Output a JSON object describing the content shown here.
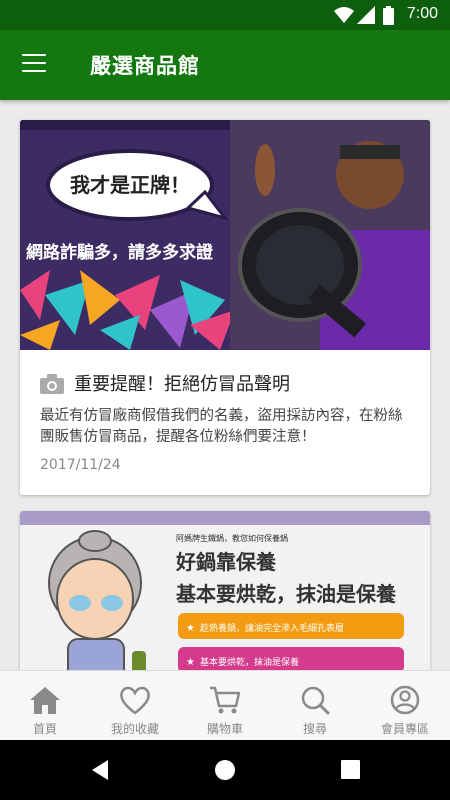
{
  "status_bar": {
    "time": "7:00"
  },
  "app_bar": {
    "title": "嚴選商品館",
    "menu_icon": "hamburger-menu-icon"
  },
  "posts": [
    {
      "banner_text_bubble": "我才是正牌！",
      "banner_text_sub": "網路詐騙多，請多多求證",
      "title": "重要提醒！拒絕仿冒品聲明",
      "description": "最近有仿冒廠商假借我們的名義，盜用採訪內容，在粉絲團販售仿冒商品，提醒各位粉絲們要注意！",
      "date": "2017/11/24"
    },
    {
      "banner_header": "阿媽牌生鐵鍋，教您如何保養鍋",
      "banner_title_1": "好鍋靠保養",
      "banner_title_2": "基本要烘乾，抹油是保養",
      "tip_1": "趁熱養鍋，讓油完全滲入毛細孔表層",
      "tip_2": "基本要烘乾，抹油是保養"
    }
  ],
  "bottom_nav": [
    {
      "label": "首頁",
      "icon": "home-icon"
    },
    {
      "label": "我的收藏",
      "icon": "heart-icon"
    },
    {
      "label": "購物車",
      "icon": "cart-icon"
    },
    {
      "label": "搜尋",
      "icon": "search-icon"
    },
    {
      "label": "會員專區",
      "icon": "account-icon"
    }
  ],
  "colors": {
    "primary": "#13780f",
    "status_bar": "#0d5f0d",
    "accent_purple": "#a89bc9",
    "tip_orange": "#f39c12",
    "tip_pink": "#d63a8c"
  }
}
